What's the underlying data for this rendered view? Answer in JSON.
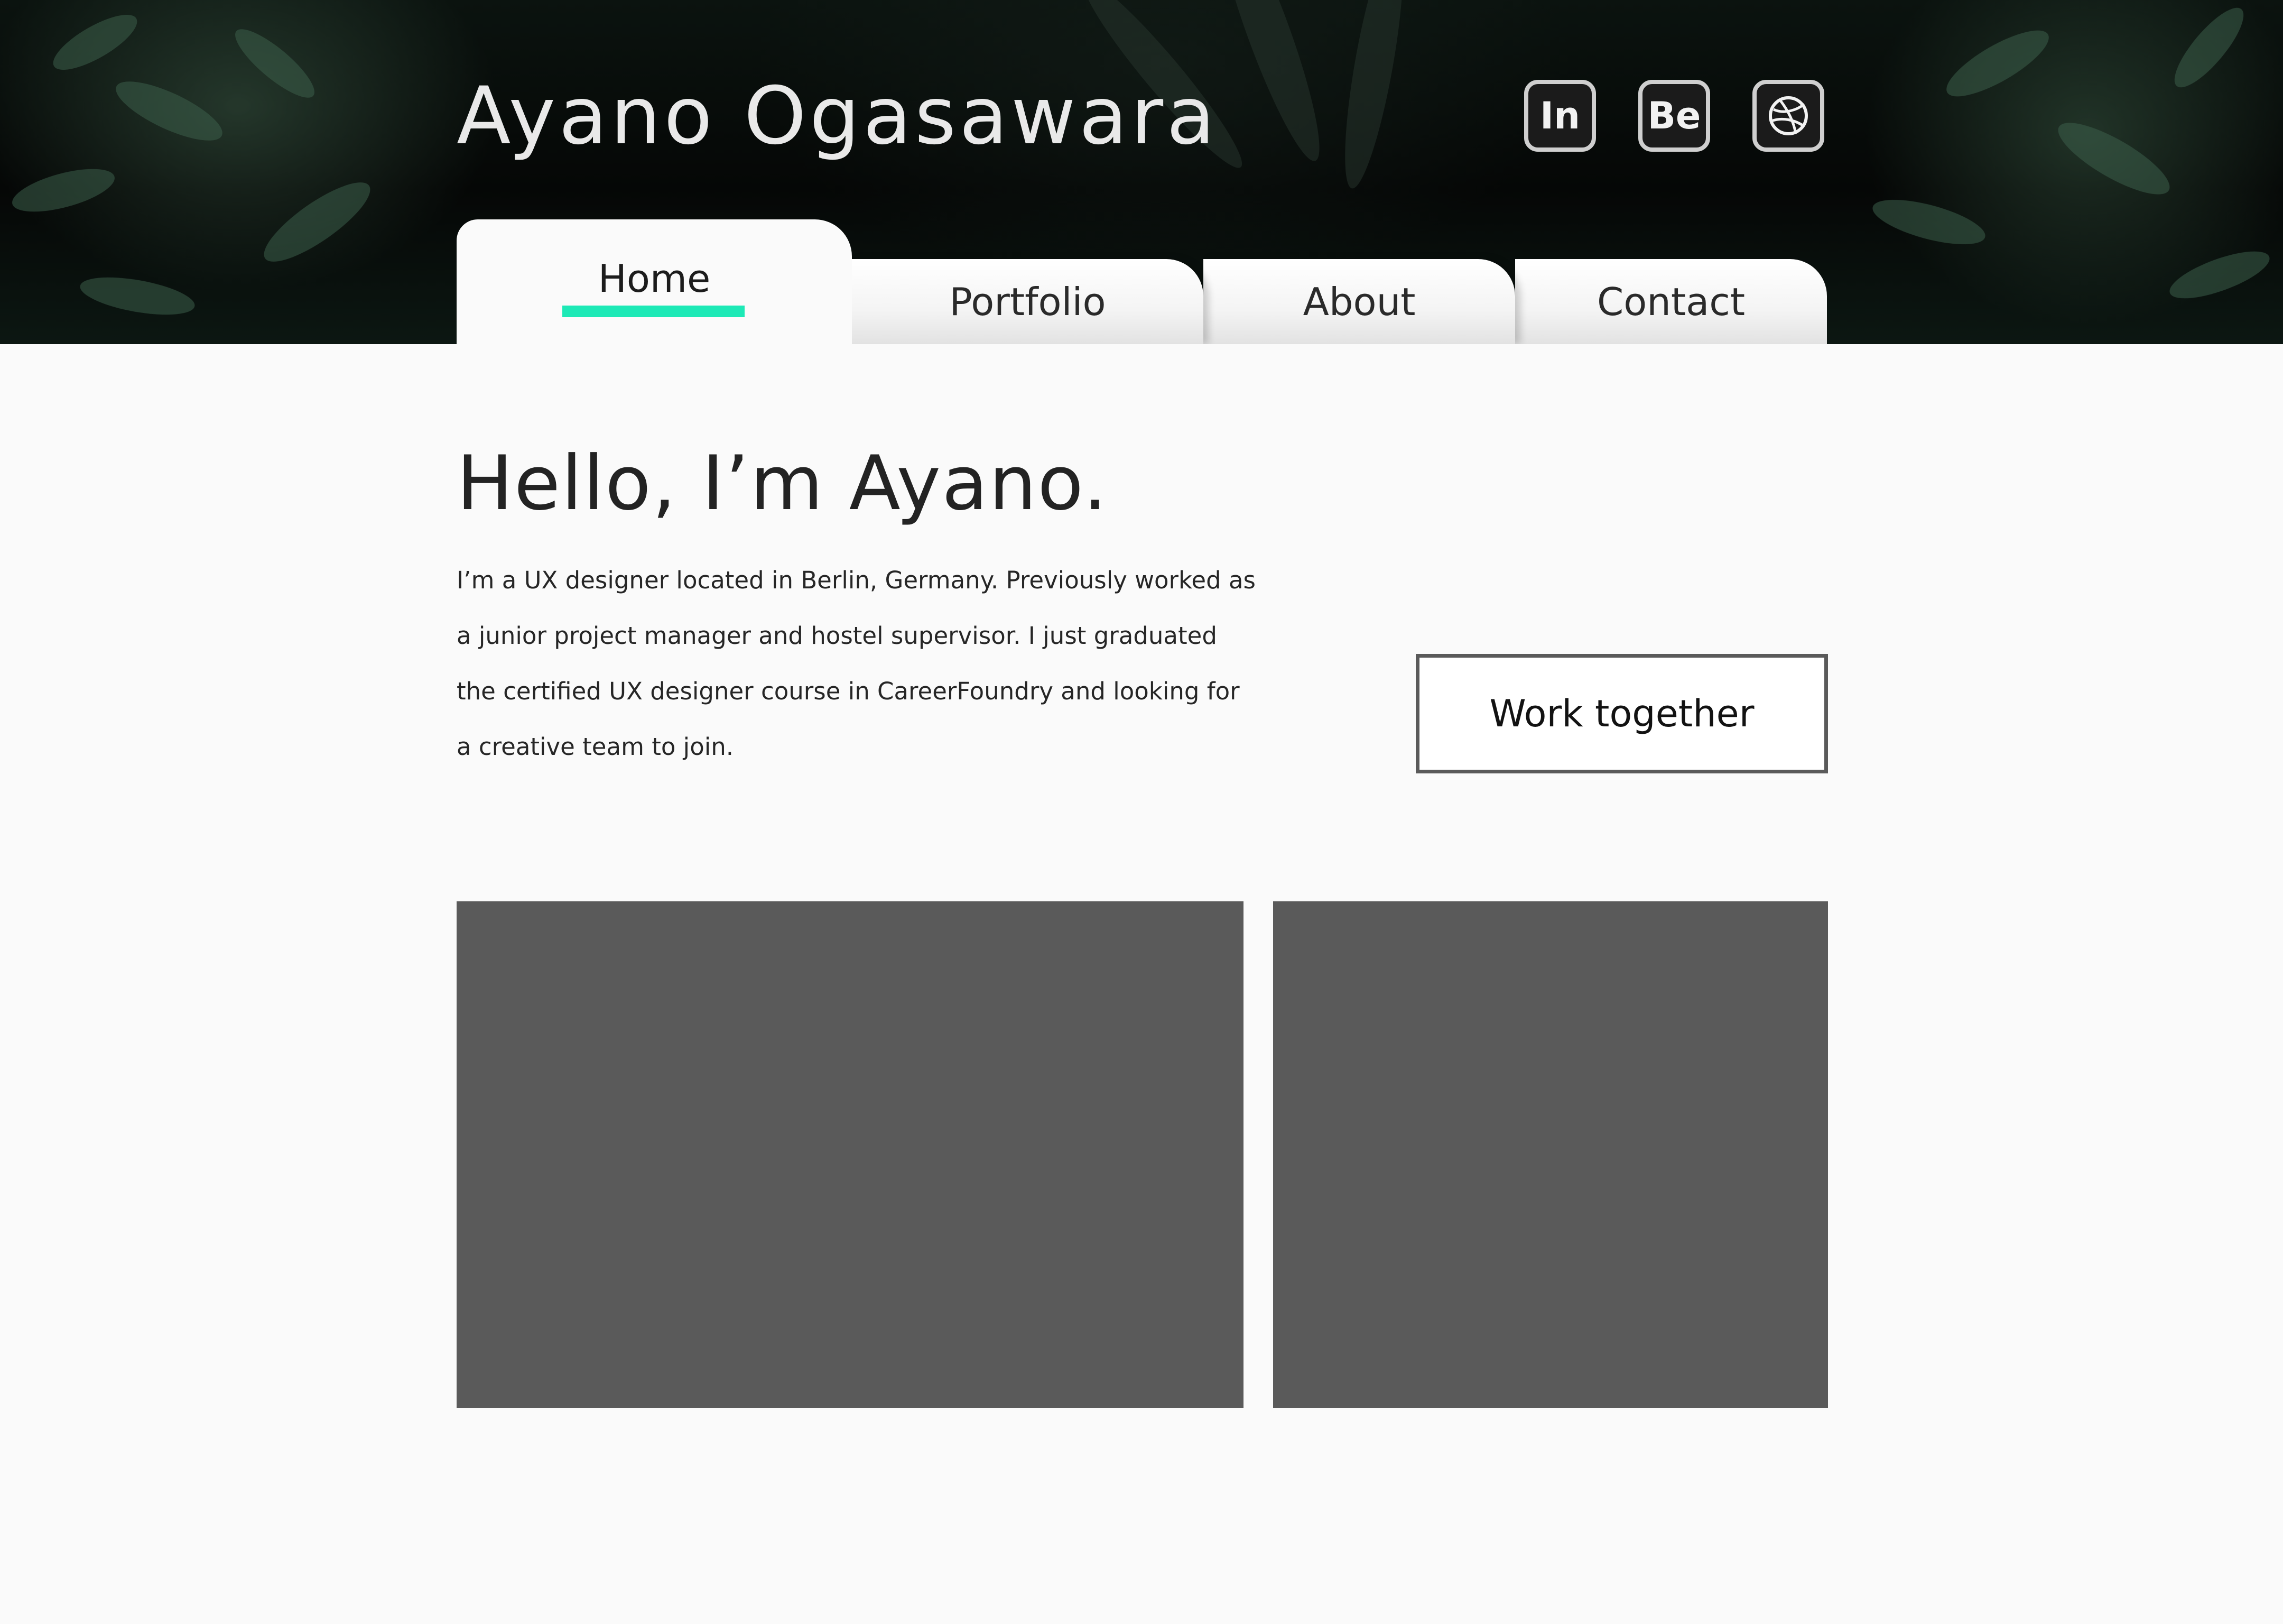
{
  "header": {
    "site_title": "Ayano Ogasawara",
    "social": [
      {
        "label": "In",
        "icon": "linkedin-icon"
      },
      {
        "label": "Be",
        "icon": "behance-icon"
      },
      {
        "label": "",
        "icon": "dribbble-icon"
      }
    ]
  },
  "nav": {
    "tabs": [
      {
        "label": "Home",
        "active": true
      },
      {
        "label": "Portfolio",
        "active": false
      },
      {
        "label": "About",
        "active": false
      },
      {
        "label": "Contact",
        "active": false
      }
    ],
    "active_accent": "#1de9b6"
  },
  "intro": {
    "heading": "Hello, I’m Ayano.",
    "body": "I’m a UX designer located in Berlin, Germany. Previously worked as a junior project manager and hostel supervisor. I just graduated the certified UX designer course in CareerFoundry and looking for a creative team to join.",
    "cta_label": "Work together"
  },
  "placeholders": {
    "color": "#5a5a5a"
  }
}
